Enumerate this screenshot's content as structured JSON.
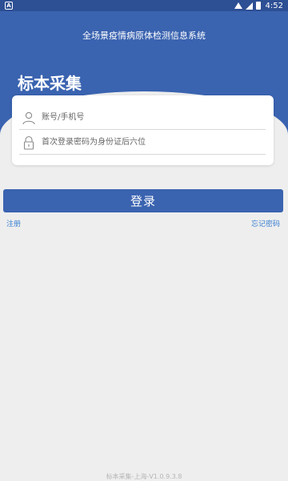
{
  "status_bar": {
    "left_badge": "A",
    "time": "4:52"
  },
  "header": {
    "app_title": "全场景疫情病原体检测信息系统",
    "page_title": "标本采集"
  },
  "form": {
    "username": {
      "placeholder": "账号/手机号",
      "value": "",
      "icon": "user-icon"
    },
    "password": {
      "placeholder": "首次登录密码为身份证后六位",
      "value": "",
      "icon": "lock-icon"
    }
  },
  "actions": {
    "login_label": "登录",
    "register_label": "注册",
    "forgot_label": "忘记密码"
  },
  "footer": {
    "version": "标本采集-上海-V1.0.9.3.8"
  },
  "colors": {
    "primary": "#3a63b0",
    "status_bar": "#2d4f94",
    "link": "#3a7fd0",
    "background": "#eeeeee"
  }
}
